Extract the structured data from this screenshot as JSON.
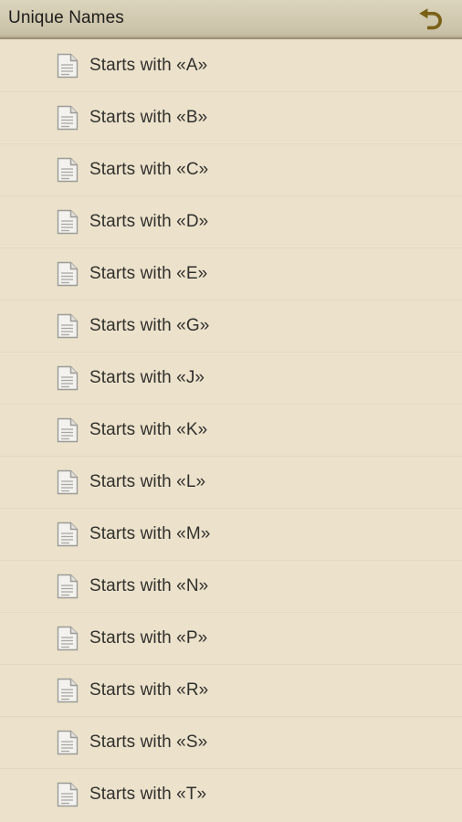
{
  "titlebar": {
    "title": "Unique Names",
    "back_icon": "back-arrow-icon",
    "back_icon_color": "#7a6117",
    "background_top": "#dcd5bd",
    "background_bottom": "#c8c0a6",
    "border_color": "#9a9178",
    "text_color": "#1d1d1b"
  },
  "theme": {
    "content_background": "#ece2cc",
    "divider_color": "#e3d8c0",
    "item_text_color": "#30302c",
    "doc_icon_fill": "#f4f2ee",
    "doc_icon_stroke": "#9b9b96",
    "doc_icon_line_color": "#a8a8a3"
  },
  "list": {
    "item_icon": "document-icon",
    "items": [
      {
        "label": "Starts with «A»"
      },
      {
        "label": "Starts with «B»"
      },
      {
        "label": "Starts with «C»"
      },
      {
        "label": "Starts with «D»"
      },
      {
        "label": "Starts with «E»"
      },
      {
        "label": "Starts with «G»"
      },
      {
        "label": "Starts with «J»"
      },
      {
        "label": "Starts with «K»"
      },
      {
        "label": "Starts with «L»"
      },
      {
        "label": "Starts with «M»"
      },
      {
        "label": "Starts with «N»"
      },
      {
        "label": "Starts with «P»"
      },
      {
        "label": "Starts with «R»"
      },
      {
        "label": "Starts with «S»"
      },
      {
        "label": "Starts with «T»"
      }
    ]
  }
}
